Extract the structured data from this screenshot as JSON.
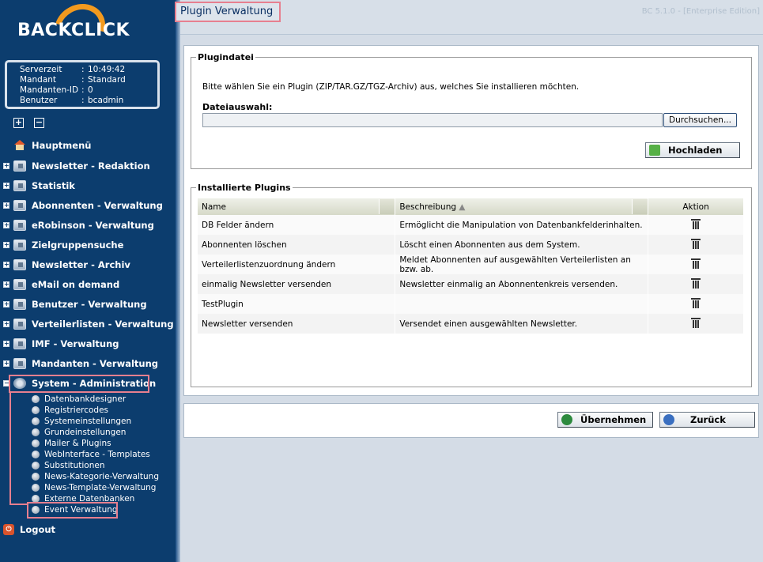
{
  "brand": {
    "logo_text": "BACKCLICK"
  },
  "info": [
    {
      "key": "Serverzeit",
      "value": "10:49:42"
    },
    {
      "key": "Mandant",
      "value": "Standard"
    },
    {
      "key": "Mandanten-ID",
      "value": "0"
    },
    {
      "key": "Benutzer",
      "value": "bcadmin"
    }
  ],
  "controls": {
    "expand": "+",
    "collapse": "−",
    "sep": ":"
  },
  "menu": {
    "hauptmenu": "Hauptmenü",
    "items": [
      "Newsletter - Redaktion",
      "Statistik",
      "Abonnenten - Verwaltung",
      "eRobinson - Verwaltung",
      "Zielgruppensuche",
      "Newsletter - Archiv",
      "eMail on demand",
      "Benutzer - Verwaltung",
      "Verteilerlisten - Verwaltung",
      "IMF - Verwaltung",
      "Mandanten - Verwaltung"
    ],
    "system": "System - Administration",
    "sub_items": [
      "Datenbankdesigner",
      "Registriercodes",
      "Systemeinstellungen",
      "Grundeinstellungen",
      "Mailer & Plugins",
      "WebInterface - Templates",
      "Substitutionen",
      "News-Kategorie-Verwaltung",
      "News-Template-Verwaltung",
      "Externe Datenbanken",
      "Event Verwaltung"
    ],
    "logout": "Logout"
  },
  "header": {
    "title": "Plugin Verwaltung",
    "version": "BC 5.1.0 - [Enterprise Edition]"
  },
  "plugin_file": {
    "legend": "Plugindatei",
    "instruction": "Bitte wählen Sie ein Plugin (ZIP/TAR.GZ/TGZ-Archiv) aus, welches Sie installieren möchten.",
    "file_label": "Dateiauswahl:",
    "browse_label": "Durchsuchen...",
    "upload_label": "Hochladen"
  },
  "installed": {
    "legend": "Installierte Plugins",
    "columns": {
      "name": "Name",
      "description": "Beschreibung",
      "action": "Aktion"
    },
    "rows": [
      {
        "name": "DB Felder ändern",
        "description": "Ermöglicht die Manipulation von Datenbankfelderinhalten."
      },
      {
        "name": "Abonnenten löschen",
        "description": "Löscht einen Abonnenten aus dem System."
      },
      {
        "name": "Verteilerlistenzuordnung ändern",
        "description": "Meldet Abonnenten auf ausgewählten Verteilerlisten an bzw. ab."
      },
      {
        "name": "einmalig Newsletter versenden",
        "description": "Newsletter einmalig an Abonnentenkreis versenden."
      },
      {
        "name": "TestPlugin",
        "description": ""
      },
      {
        "name": "Newsletter versenden",
        "description": "Versendet einen ausgewählten Newsletter."
      }
    ]
  },
  "footer": {
    "apply_label": "Übernehmen",
    "back_label": "Zurück"
  }
}
